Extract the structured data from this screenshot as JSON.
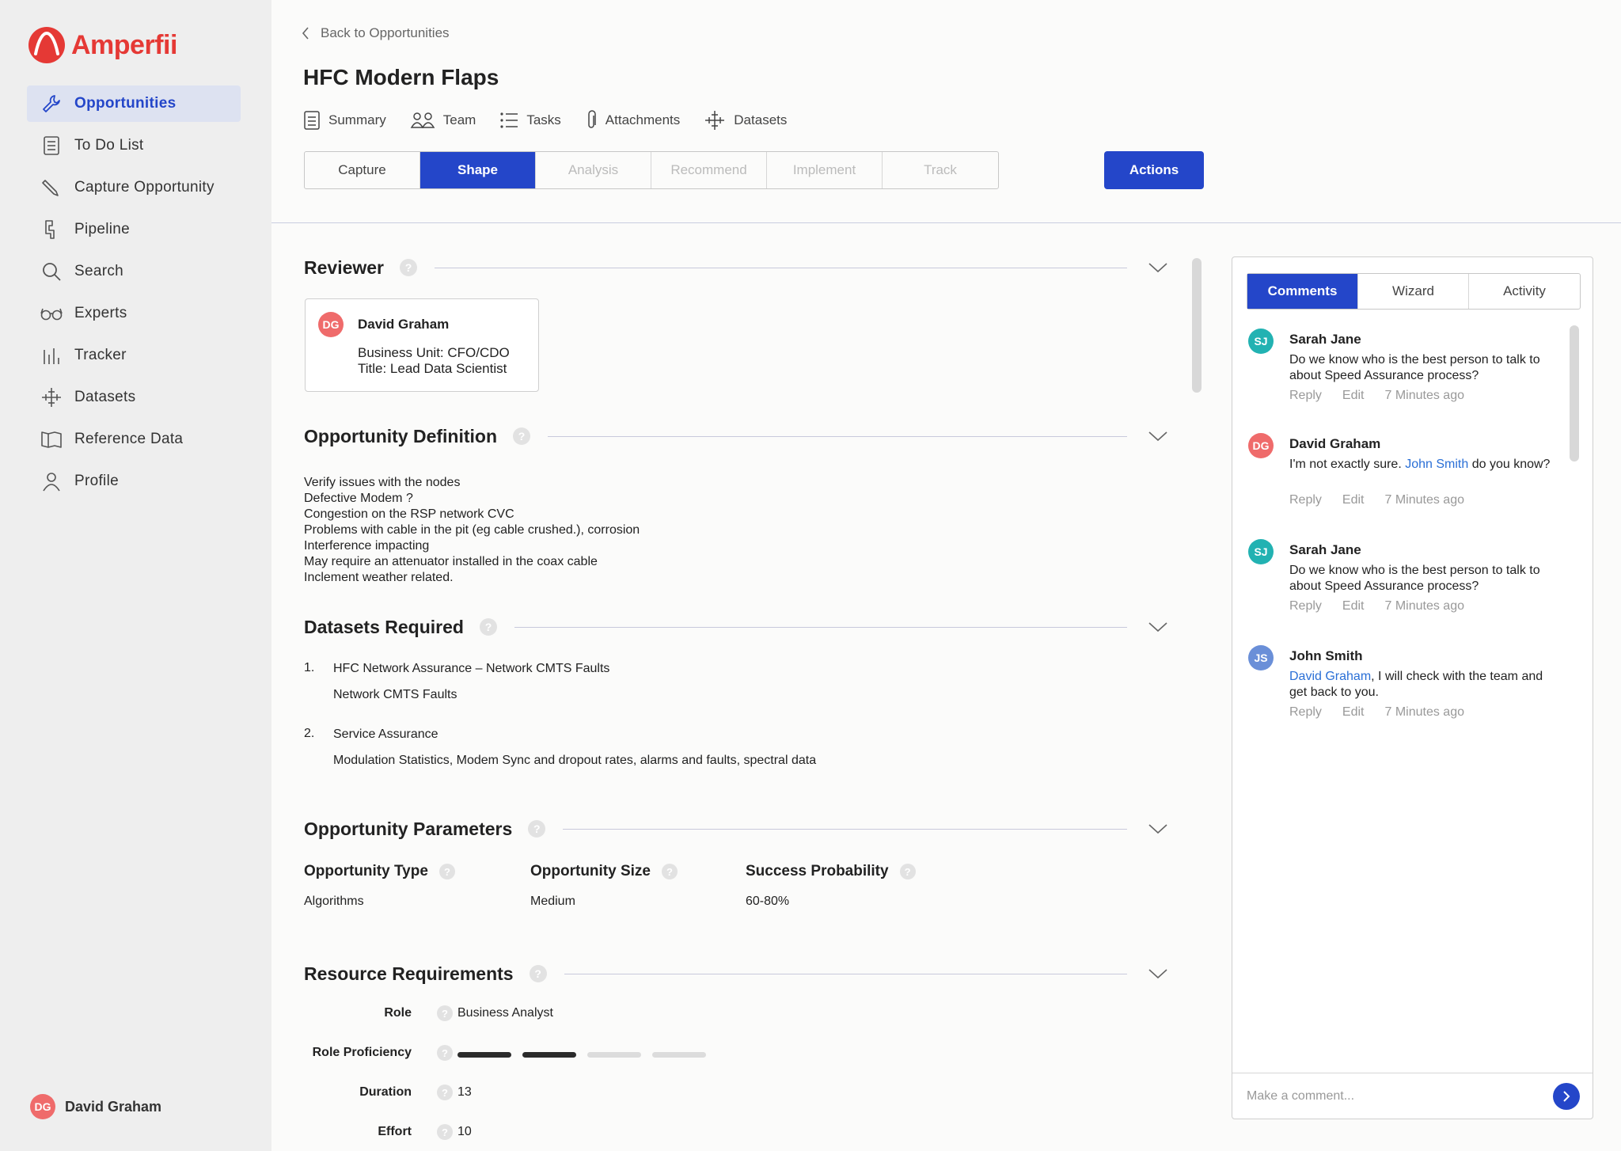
{
  "app": {
    "name": "Amperfii"
  },
  "sidebar": {
    "items": [
      {
        "label": "Opportunities",
        "icon": "wrench-icon"
      },
      {
        "label": "To Do List",
        "icon": "checklist-icon"
      },
      {
        "label": "Capture Opportunity",
        "icon": "pencil-icon"
      },
      {
        "label": "Pipeline",
        "icon": "pipeline-icon"
      },
      {
        "label": "Search",
        "icon": "search-icon"
      },
      {
        "label": "Experts",
        "icon": "glasses-icon"
      },
      {
        "label": "Tracker",
        "icon": "bar-chart-icon"
      },
      {
        "label": "Datasets",
        "icon": "datasets-icon"
      },
      {
        "label": "Reference Data",
        "icon": "book-icon"
      },
      {
        "label": "Profile",
        "icon": "user-icon"
      }
    ],
    "user": {
      "initials": "DG",
      "name": "David Graham"
    }
  },
  "header": {
    "back_label": "Back to Opportunities",
    "title": "HFC Modern Flaps",
    "tabs": [
      {
        "label": "Summary",
        "icon": "document-icon"
      },
      {
        "label": "Team",
        "icon": "team-icon"
      },
      {
        "label": "Tasks",
        "icon": "list-icon"
      },
      {
        "label": "Attachments",
        "icon": "paperclip-icon"
      },
      {
        "label": "Datasets",
        "icon": "datasets-icon"
      }
    ],
    "stages": [
      "Capture",
      "Shape",
      "Analysis",
      "Recommend",
      "Implement",
      "Track"
    ],
    "active_stage": "Shape",
    "actions_label": "Actions"
  },
  "main": {
    "reviewer": {
      "title": "Reviewer",
      "initials": "DG",
      "name": "David Graham",
      "line1": "Business Unit: CFO/CDO",
      "line2": "Title: Lead Data Scientist"
    },
    "definition": {
      "title": "Opportunity Definition",
      "lines": [
        "Verify issues with the nodes",
        "Defective Modem ?",
        "Congestion on the RSP network CVC",
        "Problems with cable in the pit (eg cable crushed.), corrosion",
        "Interference impacting",
        "May require an attenuator installed in the coax cable",
        "Inclement weather related."
      ]
    },
    "datasets": {
      "title": "Datasets Required",
      "items": [
        {
          "num": "1.",
          "title": "HFC Network Assurance – Network CMTS Faults",
          "sub": "Network CMTS Faults"
        },
        {
          "num": "2.",
          "title": "Service Assurance",
          "sub": "Modulation Statistics, Modem Sync and dropout rates, alarms and faults, spectral data"
        }
      ]
    },
    "parameters": {
      "title": "Opportunity Parameters",
      "items": [
        {
          "label": "Opportunity Type",
          "value": "Algorithms"
        },
        {
          "label": "Opportunity Size",
          "value": "Medium"
        },
        {
          "label": "Success Probability",
          "value": "60-80%"
        }
      ]
    },
    "resources": {
      "title": "Resource Requirements",
      "role_label": "Role",
      "role_value": "Business Analyst",
      "proficiency_label": "Role Proficiency",
      "proficiency_level": 2,
      "proficiency_max": 4,
      "duration_label": "Duration",
      "duration_value": "13",
      "effort_label": "Effort",
      "effort_value": "10"
    },
    "help_glyph": "?"
  },
  "panel": {
    "tabs": [
      "Comments",
      "Wizard",
      "Activity"
    ],
    "active_tab": "Comments",
    "comments": [
      {
        "initials": "SJ",
        "name": "Sarah Jane",
        "text": "Do we know who is the best person to talk to about Speed Assurance process?",
        "reply": "Reply",
        "edit": "Edit",
        "time": "7 Minutes ago"
      },
      {
        "initials": "DG",
        "name": "David Graham",
        "text_before": "I'm not exactly sure. ",
        "mention": "John Smith",
        "text_after": " do you know?",
        "reply": "Reply",
        "edit": "Edit",
        "time": "7 Minutes ago"
      },
      {
        "initials": "SJ",
        "name": "Sarah Jane",
        "text": "Do we know who is the best person to talk to about Speed Assurance process?",
        "reply": "Reply",
        "edit": "Edit",
        "time": "7 Minutes ago"
      },
      {
        "initials": "JS",
        "name": "John Smith",
        "mention": "David Graham",
        "text_after": ", I will check with the team and get back to you.",
        "reply": "Reply",
        "edit": "Edit",
        "time": "7 Minutes ago"
      }
    ],
    "composer_placeholder": "Make a comment..."
  },
  "colors": {
    "brand": "#e53935",
    "accent": "#2446c9",
    "mention": "#2a6fd6"
  }
}
